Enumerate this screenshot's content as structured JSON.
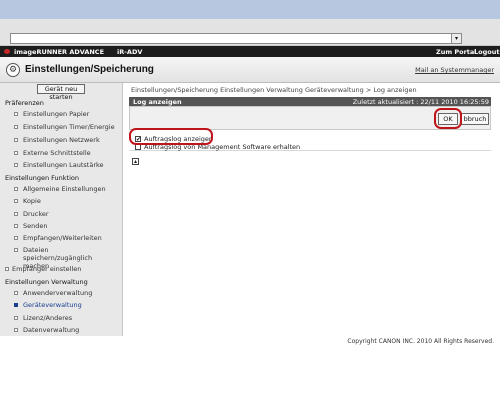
{
  "browser": {
    "url": "",
    "dropdown_glyph": "▾"
  },
  "app": {
    "brand": "imageRUNNER ADVANCE",
    "model": "iR-ADV",
    "portal": "Zum Portal",
    "logout": "Logout"
  },
  "title": {
    "icon": "⚙",
    "text": "Einstellungen/Speicherung",
    "mail": "Mail an Systemmanager"
  },
  "sidebar": {
    "restart": "Gerät neu starten",
    "items": [
      {
        "label": "Präferenzen",
        "kind": "h"
      },
      {
        "label": "Einstellungen Papier",
        "kind": "c"
      },
      {
        "label": "Einstellungen Timer/Energie",
        "kind": "c"
      },
      {
        "label": "Einstellungen Netzwerk",
        "kind": "c"
      },
      {
        "label": "Externe Schnittstelle",
        "kind": "c"
      },
      {
        "label": "Einstellungen Lautstärke",
        "kind": "c"
      },
      {
        "label": "Einstellungen Funktion",
        "kind": "h"
      },
      {
        "label": "Allgemeine Einstellungen",
        "kind": "c"
      },
      {
        "label": "Kopie",
        "kind": "c"
      },
      {
        "label": "Drucker",
        "kind": "c"
      },
      {
        "label": "Senden",
        "kind": "c"
      },
      {
        "label": "Empfangen/Weiterleiten",
        "kind": "c"
      },
      {
        "label": "Dateien speichern/zugänglich machen",
        "kind": "c"
      },
      {
        "label": "Empfänger einstellen",
        "kind": "e"
      },
      {
        "label": "Einstellungen Verwaltung",
        "kind": "h"
      },
      {
        "label": "Anwenderverwaltung",
        "kind": "c"
      },
      {
        "label": "Geräteverwaltung",
        "kind": "c",
        "selected": true
      },
      {
        "label": "Lizenz/Anderes",
        "kind": "c"
      },
      {
        "label": "Datenverwaltung",
        "kind": "c"
      }
    ]
  },
  "main": {
    "breadcrumb": {
      "a": "Einstellungen/Speicherung",
      "b": "Einstellungen Verwaltung",
      "c": "Geräteverwaltung",
      "sep": " > ",
      "d": "Log anzeigen"
    },
    "panel_title": "Log anzeigen",
    "updated": "Zuletzt aktualisiert : 22/11 2010 16:25:59",
    "ok": "OK",
    "cancel": "bbruch",
    "options": [
      {
        "label": "Auftragslog anzeigen",
        "checked": true
      },
      {
        "label": "Auftragslog von Management Software erhalten",
        "checked": false
      }
    ],
    "collapse_glyph": "▴"
  },
  "footer": {
    "copyright": "Copyright CANON INC. 2010 All Rights Reserved."
  },
  "colors": {
    "highlight": "#c0141b",
    "appbar": "#1d1d1d",
    "panel_head": "#555555"
  }
}
